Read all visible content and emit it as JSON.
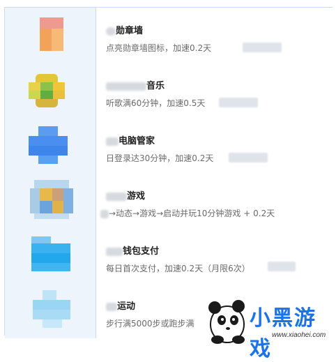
{
  "items": [
    {
      "title": "勋章墙",
      "subtitle": "点亮勋章墙图标，加速0.2天"
    },
    {
      "title": "音乐",
      "subtitle": "听歌满60分钟，加速0.5天"
    },
    {
      "title": "电脑管家",
      "subtitle": "日登录达30分钟，加速0.2天"
    },
    {
      "title": "游戏",
      "subtitle": "→动态→游戏→启动并玩10分钟游戏   + 0.2天"
    },
    {
      "title": "钱包支付",
      "subtitle": "每日首次支付，加速0.2天（月限6次）"
    },
    {
      "title": "运动",
      "subtitle": "步行满5000步或跑步满"
    }
  ],
  "watermark": {
    "text": "小黑游戏",
    "url": "www.xiaohei.com"
  },
  "icons": [
    "medal-icon",
    "music-icon",
    "pc-manager-icon",
    "game-icon",
    "wallet-icon",
    "sport-icon"
  ],
  "colors": {
    "border": "#c9dcef",
    "icon_column_bg": "#edf4fb",
    "logo_blue": "#1a73e8"
  }
}
